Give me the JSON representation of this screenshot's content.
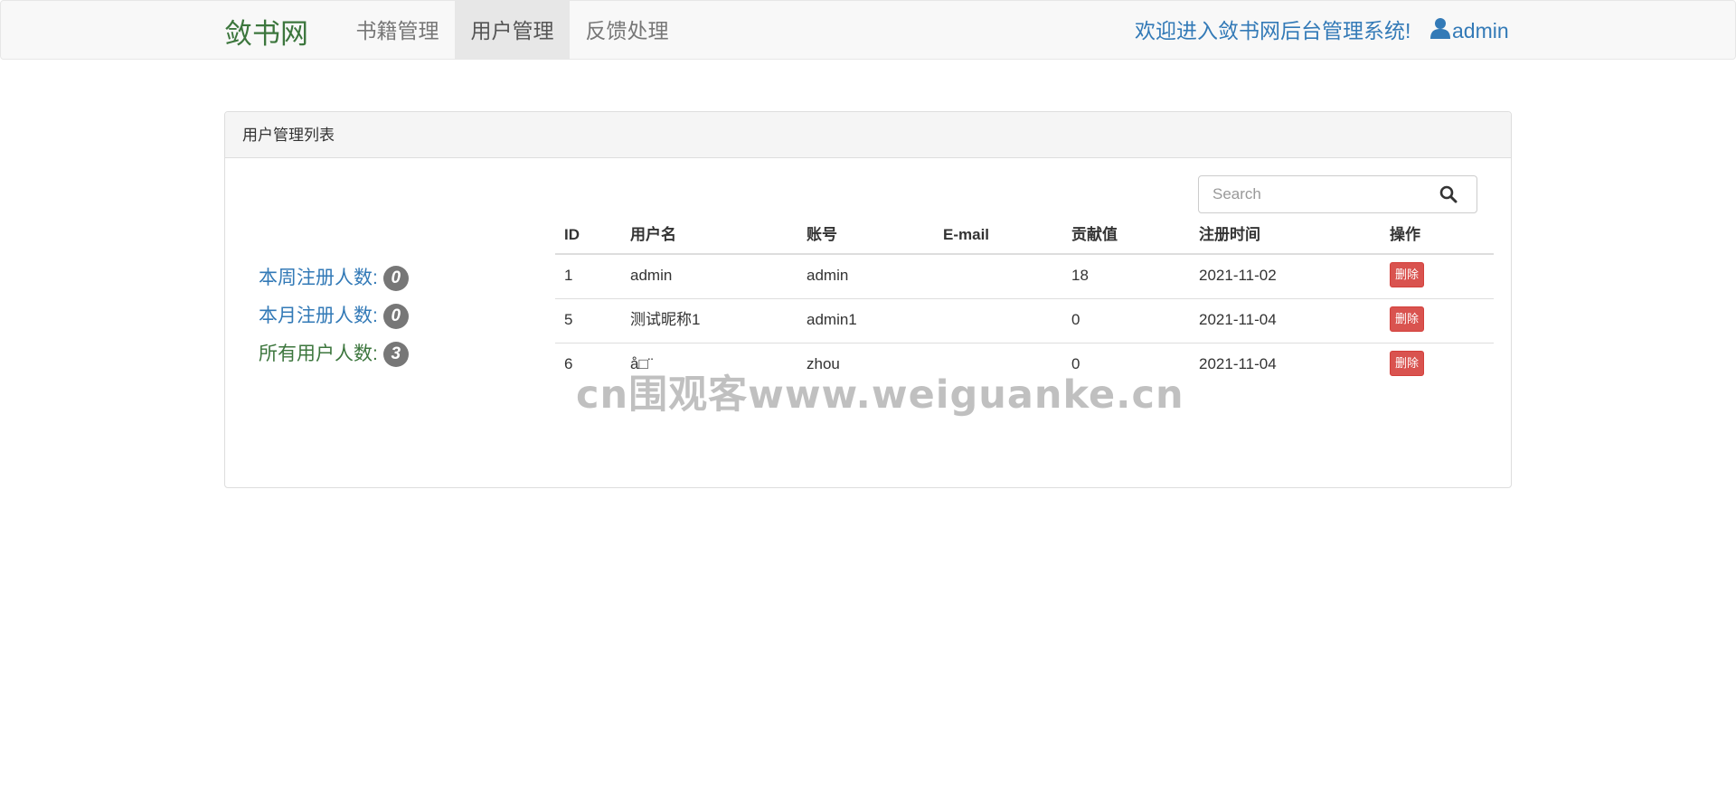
{
  "nav": {
    "brand": "敛书网",
    "items": [
      {
        "label": "书籍管理"
      },
      {
        "label": "用户管理"
      },
      {
        "label": "反馈处理"
      }
    ],
    "welcome": "欢迎进入敛书网后台管理系统!",
    "user": "admin"
  },
  "panel": {
    "title": "用户管理列表",
    "stats": [
      {
        "label": "本周注册人数:",
        "value": "0"
      },
      {
        "label": "本月注册人数:",
        "value": "0"
      },
      {
        "label": "所有用户人数:",
        "value": "3"
      }
    ]
  },
  "search": {
    "placeholder": "Search"
  },
  "table": {
    "headers": [
      "ID",
      "用户名",
      "账号",
      "E-mail",
      "贡献值",
      "注册时间",
      "操作"
    ],
    "rows": [
      {
        "id": "1",
        "username": "admin",
        "account": "admin",
        "email": "",
        "contribution": "18",
        "date": "2021-11-02",
        "action": "删除"
      },
      {
        "id": "5",
        "username": "测试昵称1",
        "account": "admin1",
        "email": "",
        "contribution": "0",
        "date": "2021-11-04",
        "action": "删除"
      },
      {
        "id": "6",
        "username": "å□¨",
        "account": "zhou",
        "email": "",
        "contribution": "0",
        "date": "2021-11-04",
        "action": "删除"
      }
    ]
  },
  "watermark": "cn围观客www.weiguanke.cn",
  "colors": {
    "brand": "#3c763d",
    "link": "#337ab7",
    "danger": "#d9534f",
    "badge": "#777777"
  }
}
